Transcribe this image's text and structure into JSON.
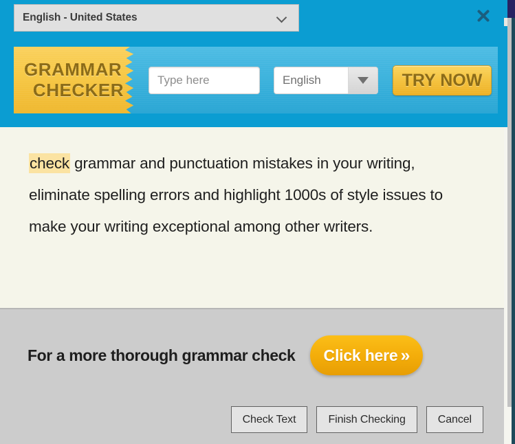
{
  "header": {
    "language_select": {
      "value": "English - United States",
      "icon": "chevron-down-icon"
    },
    "close_icon": "close-icon"
  },
  "ad_banner": {
    "badge_line_1": "GRAMMAR",
    "badge_line_2": "CHECKER",
    "input_placeholder": "Type here",
    "input_value": "",
    "language_value": "English",
    "language_dropdown_icon": "triangle-down-icon",
    "cta_label": "TRY NOW"
  },
  "document": {
    "highlighted_word": "check",
    "paragraph_rest": " grammar and punctuation mistakes in your writing, eliminate spelling errors and highlight 1000s of style issues to make your writing exceptional among other writers."
  },
  "promo": {
    "text": "For a more thorough grammar check",
    "button_label": "Click here",
    "button_icon": "»"
  },
  "dialog_buttons": [
    {
      "label": "Check Text"
    },
    {
      "label": "Finish Checking"
    },
    {
      "label": "Cancel"
    }
  ],
  "colors": {
    "header_blue": "#0b9dd2",
    "banner_gold": "#f7c947",
    "highlight_yellow": "#fbe3a2",
    "paper_cream": "#f5f5ea",
    "footer_gray": "#cccccc",
    "cta_orange": "#f3ac09",
    "edge_navy": "#272262",
    "edge_teal": "#1e4a5a"
  }
}
